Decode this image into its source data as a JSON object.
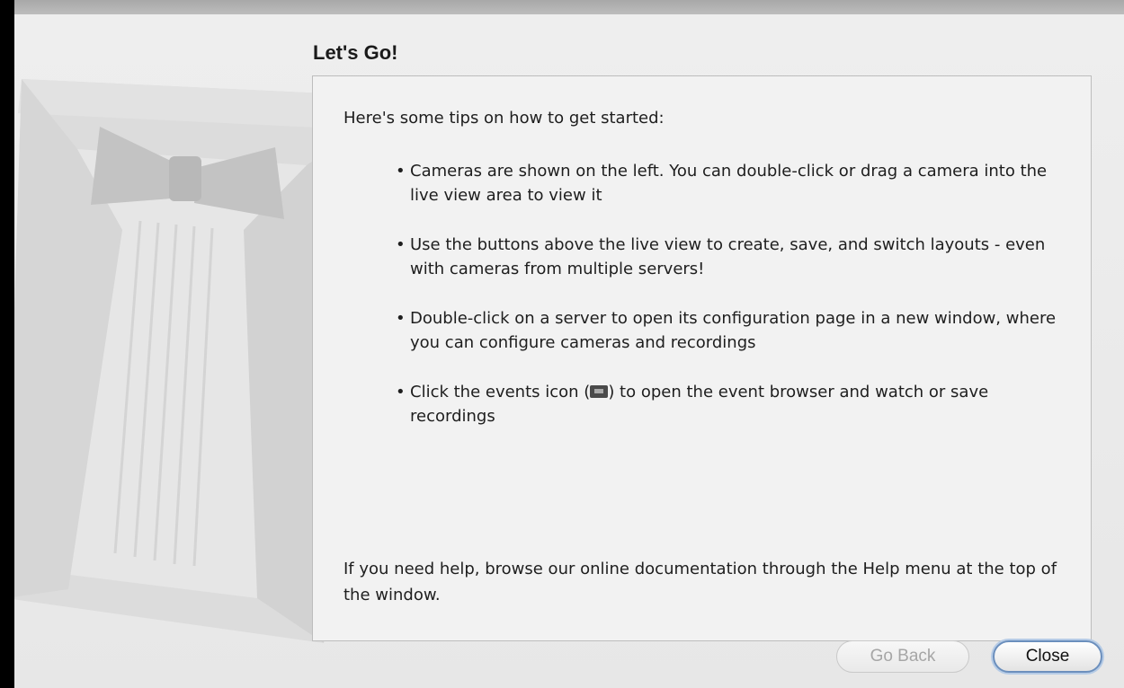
{
  "dialog": {
    "title": "Let's Go!",
    "intro": "Here's some tips on how to get started:",
    "tips": [
      "Cameras are shown on the left. You can double-click or drag a camera into the live view area to view it",
      "Use the buttons above the live view to create, save, and switch layouts - even with cameras from multiple servers!",
      "Double-click on a server to open its configuration page in a new window, where you can configure cameras and recordings"
    ],
    "events_tip": {
      "before": "Click the events icon (",
      "icon": "events-icon",
      "after": ") to open the event browser and watch or save recordings"
    },
    "footer": "If you need help, browse our online documentation through the Help menu at the top of the window.",
    "buttons": {
      "back": "Go Back",
      "close": "Close"
    },
    "bullet": "•",
    "decorative_artwork": "tuxedo-bowtie-artwork"
  }
}
